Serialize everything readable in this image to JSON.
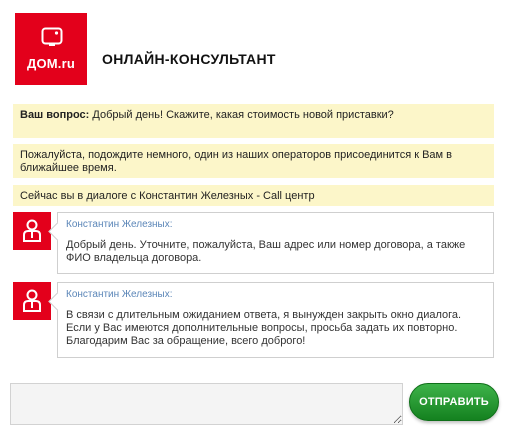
{
  "brand": {
    "logo_text": "ДОМ.ru",
    "color": "#e3001b"
  },
  "header": {
    "title": "ОНЛАЙН-КОНСУЛЬТАНТ"
  },
  "notices": {
    "question_label": "Ваш вопрос:",
    "question_text": " Добрый день! Скажите, какая стоимость новой приставки?",
    "wait_text": "Пожалуйста, подождите немного, один из наших операторов присоединится к Вам в ближайшее время.",
    "dialog_text": "Сейчас вы в диалоге с Константин Железных - Call центр"
  },
  "messages": [
    {
      "author": "Константин Железных:",
      "text": "Добрый день. Уточните, пожалуйста, Ваш адрес или номер договора, а также ФИО владельца договора."
    },
    {
      "author": "Константин Железных:",
      "text": "В связи с длительным ожиданием ответа, я вынужден закрыть окно диалога. Если у Вас имеются дополнительные вопросы, просьба задать их повторно. Благодарим Вас за обращение, всего доброго!"
    }
  ],
  "composer": {
    "placeholder": "",
    "send_label": "ОТПРАВИТЬ",
    "send_color": "#1e9a2b"
  },
  "icons": {
    "logo": "tv-icon",
    "avatar": "operator-icon"
  }
}
